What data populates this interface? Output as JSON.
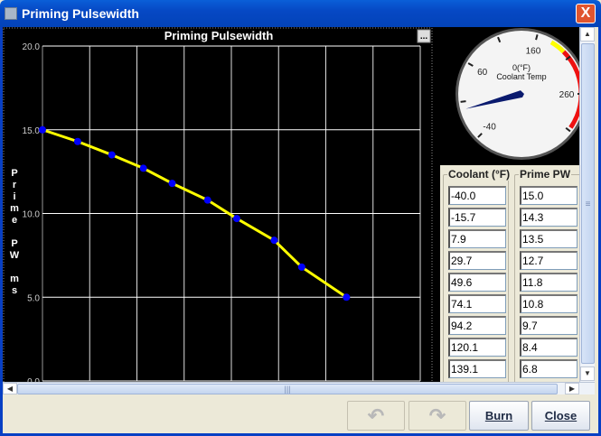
{
  "window": {
    "title": "Priming Pulsewidth",
    "close_label": "X"
  },
  "chart_data": {
    "type": "line",
    "title": "Priming Pulsewidth",
    "xlabel": "Coolant (°F)",
    "ylabel": "Prime PW ms",
    "ylim": [
      0,
      20
    ],
    "xlim": [
      -40,
      221
    ],
    "yticks": [
      "20.0",
      "15.0",
      "10.0",
      "5.0",
      "0.0"
    ],
    "grid": true,
    "x": [
      -40.0,
      -15.7,
      7.9,
      29.7,
      49.6,
      74.1,
      94.2,
      120.1,
      139.1,
      170
    ],
    "y": [
      15.0,
      14.3,
      13.5,
      12.7,
      11.8,
      10.8,
      9.7,
      8.4,
      6.8,
      5.0
    ],
    "line_color": "#ffff00",
    "point_color": "#0000ff",
    "menu_label": "..."
  },
  "gauge": {
    "title": "Coolant Temp",
    "value_label": "0(°F)",
    "value": 0,
    "min": -40,
    "max": 260,
    "labels": [
      "-40",
      "60",
      "160",
      "260"
    ],
    "warn_color": "#ffff00",
    "danger_color": "#ee1111"
  },
  "table": {
    "headers": [
      "Coolant (°F)",
      "Prime PW"
    ],
    "coolant": [
      "-40.0",
      "-15.7",
      "7.9",
      "29.7",
      "49.6",
      "74.1",
      "94.2",
      "120.1",
      "139.1"
    ],
    "prime_pw": [
      "15.0",
      "14.3",
      "13.5",
      "12.7",
      "11.8",
      "10.8",
      "9.7",
      "8.4",
      "6.8"
    ]
  },
  "buttons": {
    "undo": "↶",
    "redo": "↷",
    "burn": "Burn",
    "close": "Close"
  }
}
